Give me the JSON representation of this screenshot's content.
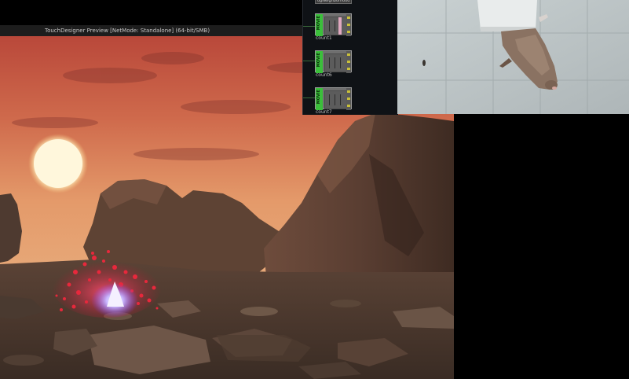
{
  "preview": {
    "title": "TouchDesigner Preview [NetMode: Standalone]  (64-bit/SMB)"
  },
  "network": {
    "top_label": "ogNeighborhood",
    "nodes": [
      {
        "name": "count1",
        "flag": "MOVIE"
      },
      {
        "name": "count6",
        "flag": "MOVIE"
      },
      {
        "name": "count7",
        "flag": "MOVIE"
      }
    ]
  },
  "colors": {
    "sky_top": "#c75a45",
    "sky_horizon": "#e8a070",
    "sun": "#fff6d8",
    "rock": "#5a4034",
    "ground": "#4a3a30",
    "particles": "#e8283c",
    "flare": "#b8a8ff",
    "node_flag": "#3bbf3b"
  }
}
